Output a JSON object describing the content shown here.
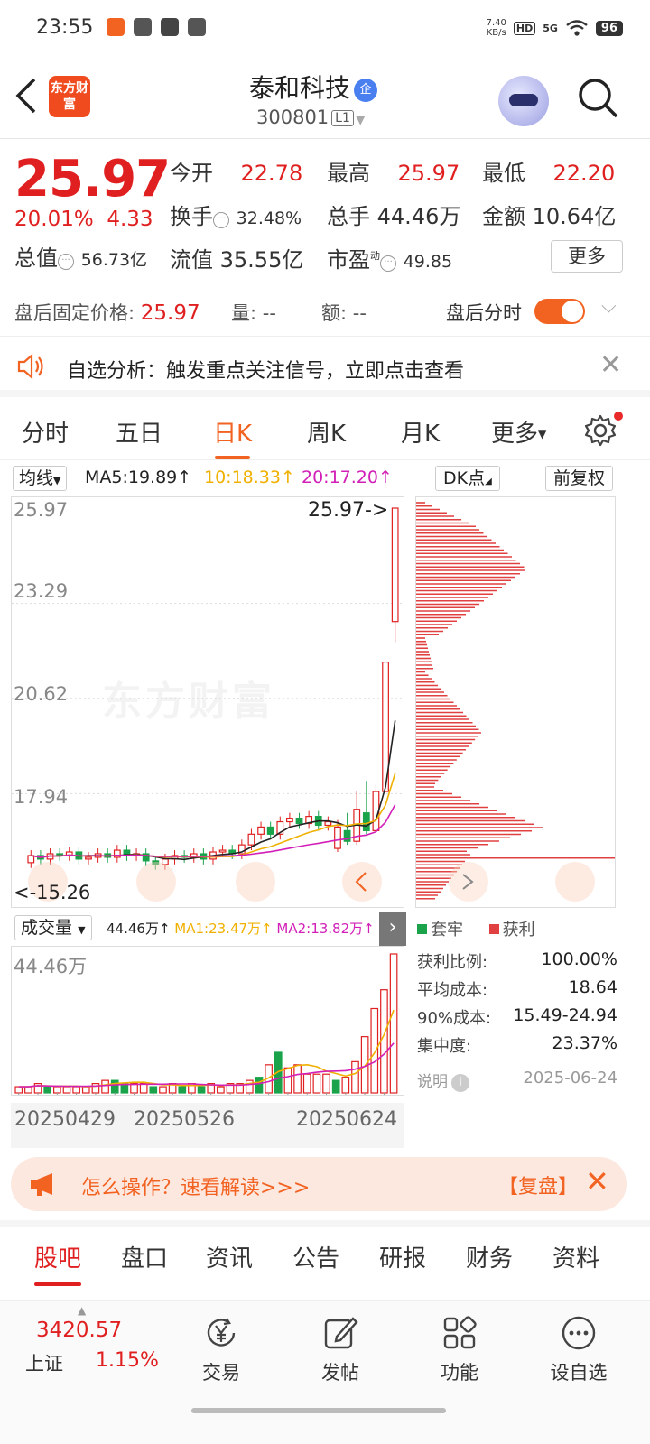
{
  "status_bar": {
    "time": "23:55",
    "net_speed_value": "7.40",
    "net_speed_unit": "KB/s",
    "hd": "HD",
    "network": "5G",
    "battery": "96"
  },
  "header": {
    "logo_text": "东方财富",
    "stock_name": "泰和科技",
    "qi_badge": "企",
    "stock_code": "300801",
    "level_tag": "L1"
  },
  "quote": {
    "price": "25.97",
    "change_pct": "20.01%",
    "change_amt": "4.33",
    "open_label": "今开",
    "open": "22.78",
    "high_label": "最高",
    "high": "25.97",
    "low_label": "最低",
    "low": "22.20",
    "turnover_label": "换手",
    "turnover": "32.48%",
    "volume_label": "总手",
    "volume": "44.46万",
    "amount_label": "金额",
    "amount": "10.64亿",
    "total_value_label": "总值",
    "total_value": "56.73亿",
    "float_value_label": "流值",
    "float_value": "35.55亿",
    "pe_label": "市盈",
    "pe_sup": "动",
    "pe": "49.85",
    "more_label": "更多"
  },
  "after_hours": {
    "fixed_price_label": "盘后固定价格:",
    "fixed_price": "25.97",
    "vol_label": "量:",
    "vol": "--",
    "amt_label": "额:",
    "amt": "--",
    "intraday_label": "盘后分时"
  },
  "notice": {
    "text": "自选分析：触发重点关注信号，立即点击查看"
  },
  "period_tabs": [
    {
      "label": "分时"
    },
    {
      "label": "五日"
    },
    {
      "label": "日K"
    },
    {
      "label": "周K"
    },
    {
      "label": "月K"
    },
    {
      "label": "更多"
    }
  ],
  "ma_bar": {
    "selector": "均线",
    "ma5": "MA5:19.89",
    "ma10": "10:18.33",
    "ma20": "20:17.20",
    "dk_label": "DK点",
    "fq_label": "前复权"
  },
  "kline": {
    "y_labels": [
      "25.97",
      "23.29",
      "20.62",
      "17.94"
    ],
    "high_marker": "25.97->",
    "low_marker": "<-15.26",
    "watermark": "东方财富"
  },
  "chip": {
    "legend_trapped": "套牢",
    "legend_profit": "获利",
    "stats": [
      {
        "label": "获利比例:",
        "value": "100.00%"
      },
      {
        "label": "平均成本:",
        "value": "18.64"
      },
      {
        "label": "90%成本:",
        "value": "15.49-24.94"
      },
      {
        "label": "集中度:",
        "value": "23.37%"
      }
    ],
    "note_label": "说明",
    "date": "2025-06-24"
  },
  "volume": {
    "selector": "成交量",
    "current": "44.46万",
    "ma1": "MA1:23.47万",
    "ma2": "MA2:13.82万",
    "max_label": "44.46万",
    "dates": [
      "20250429",
      "20250526",
      "20250624"
    ]
  },
  "promo": {
    "text": "怎么操作？速看解读>>>",
    "review": "【复盘】"
  },
  "bottom_tabs": [
    {
      "label": "股吧"
    },
    {
      "label": "盘口"
    },
    {
      "label": "资讯"
    },
    {
      "label": "公告"
    },
    {
      "label": "研报"
    },
    {
      "label": "财务"
    },
    {
      "label": "资料"
    }
  ],
  "dock": {
    "index_value": "3420.57",
    "index_name": "上证",
    "index_pct": "1.15%",
    "items": [
      {
        "label": "交易"
      },
      {
        "label": "发帖"
      },
      {
        "label": "功能"
      },
      {
        "label": "设自选"
      }
    ]
  },
  "colors": {
    "up": "#e02020",
    "down": "#1aa34a",
    "accent": "#f26322",
    "ma5": "#222222",
    "ma10": "#f0b000",
    "ma20": "#d21fb8"
  },
  "chart_data": [
    {
      "type": "candlestick",
      "title": "",
      "y_ticks": [
        25.97,
        23.29,
        20.62,
        17.94
      ],
      "ylim": [
        15.26,
        25.97
      ],
      "candles_recent": [
        {
          "open": 16.4,
          "close": 17.0,
          "high": 17.2,
          "low": 16.3
        },
        {
          "open": 16.9,
          "close": 16.6,
          "high": 17.4,
          "low": 16.5
        },
        {
          "open": 16.6,
          "close": 17.5,
          "high": 18.0,
          "low": 16.5
        },
        {
          "open": 17.4,
          "close": 16.9,
          "high": 18.3,
          "low": 16.8
        },
        {
          "open": 16.9,
          "close": 18.0,
          "high": 18.2,
          "low": 16.9
        },
        {
          "open": 18.0,
          "close": 21.64,
          "high": 21.64,
          "low": 18.0
        },
        {
          "open": 22.78,
          "close": 25.97,
          "high": 25.97,
          "low": 22.2
        }
      ],
      "ma5": 19.89,
      "ma10": 18.33,
      "ma20": 17.2
    },
    {
      "type": "bar",
      "title": "",
      "series": [
        {
          "name": "成交量",
          "values": [
            2,
            2,
            3,
            2,
            2,
            2,
            2,
            2,
            3,
            4,
            4,
            3,
            3,
            3,
            2,
            2,
            3,
            2,
            3,
            2,
            3,
            2,
            3,
            3,
            4,
            5,
            9,
            13,
            8,
            9,
            6,
            6,
            6,
            4,
            5,
            10,
            18,
            27,
            33,
            44.46
          ]
        }
      ],
      "ylim": [
        0,
        44.46
      ],
      "unit": "万"
    }
  ]
}
